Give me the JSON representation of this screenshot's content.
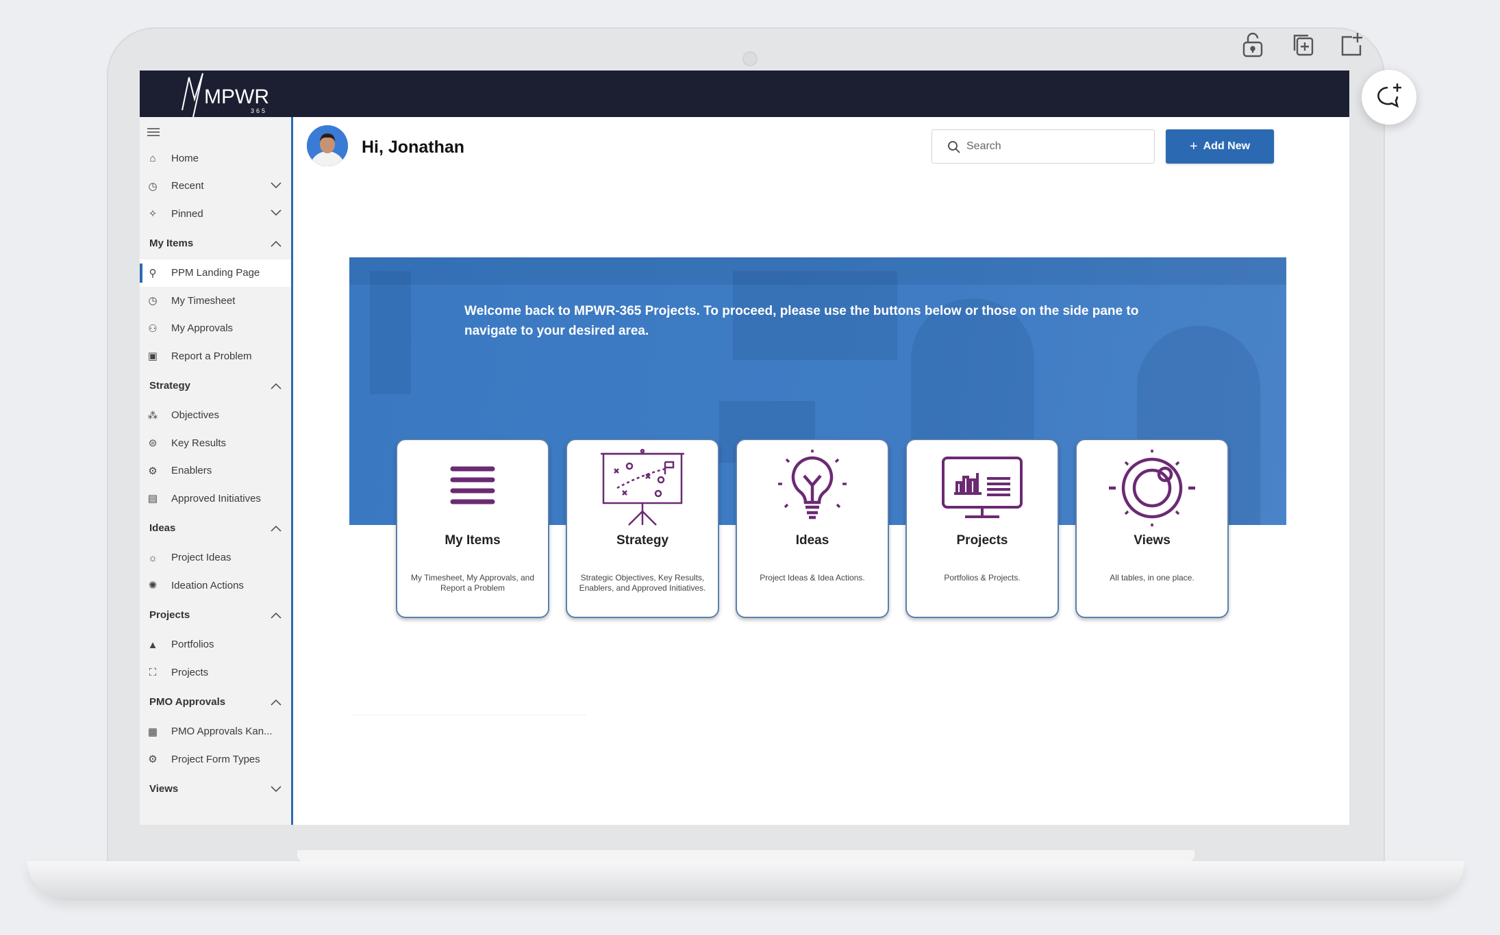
{
  "brand": {
    "logo_text": "MPWR",
    "logo_sub": "365"
  },
  "header": {
    "greeting": "Hi, Jonathan",
    "search_placeholder": "Search",
    "add_new_label": "Add New"
  },
  "sidebar": {
    "top_items": [
      {
        "label": "Home",
        "icon": "home-icon"
      },
      {
        "label": "Recent",
        "icon": "clock-icon"
      },
      {
        "label": "Pinned",
        "icon": "pin-icon"
      }
    ],
    "sections": [
      {
        "title": "My Items",
        "items": [
          {
            "label": "PPM Landing Page",
            "icon": "pushpin-icon",
            "active": true
          },
          {
            "label": "My Timesheet",
            "icon": "clock-icon"
          },
          {
            "label": "My Approvals",
            "icon": "people-icon"
          },
          {
            "label": "Report a Problem",
            "icon": "report-icon"
          }
        ]
      },
      {
        "title": "Strategy",
        "items": [
          {
            "label": "Objectives",
            "icon": "objectives-icon"
          },
          {
            "label": "Key Results",
            "icon": "search-list-icon"
          },
          {
            "label": "Enablers",
            "icon": "enablers-icon"
          },
          {
            "label": "Approved Initiatives",
            "icon": "clipboard-icon"
          }
        ]
      },
      {
        "title": "Ideas",
        "items": [
          {
            "label": "Project Ideas",
            "icon": "bulb-icon"
          },
          {
            "label": "Ideation Actions",
            "icon": "gear-icon"
          }
        ]
      },
      {
        "title": "Projects",
        "items": [
          {
            "label": "Portfolios",
            "icon": "triangle-icon"
          },
          {
            "label": "Projects",
            "icon": "network-icon"
          }
        ]
      },
      {
        "title": "PMO Approvals",
        "items": [
          {
            "label": "PMO Approvals Kan...",
            "icon": "board-icon"
          },
          {
            "label": "Project Form Types",
            "icon": "form-icon"
          }
        ]
      },
      {
        "title": "Views",
        "items": []
      }
    ]
  },
  "banner": {
    "welcome_text": "Welcome back to MPWR-365 Projects. To proceed, please use the buttons below or those on the side pane to navigate to your desired area."
  },
  "cards": [
    {
      "title": "My Items",
      "description": "My Timesheet, My Approvals, and Report a Problem",
      "icon": "list-icon"
    },
    {
      "title": "Strategy",
      "description": "Strategic Objectives, Key Results, Enablers, and Approved Initiatives.",
      "icon": "strategy-board-icon"
    },
    {
      "title": "Ideas",
      "description": "Project Ideas & Idea Actions.",
      "icon": "lightbulb-icon"
    },
    {
      "title": "Projects",
      "description": "Portfolios & Projects.",
      "icon": "monitor-chart-icon"
    },
    {
      "title": "Views",
      "description": "All tables, in one place.",
      "icon": "views-icon"
    }
  ],
  "colors": {
    "topbar": "#1b1f31",
    "accent": "#2b6ab3",
    "banner": "#3f7cc4",
    "icon_purple": "#6b2a73"
  }
}
